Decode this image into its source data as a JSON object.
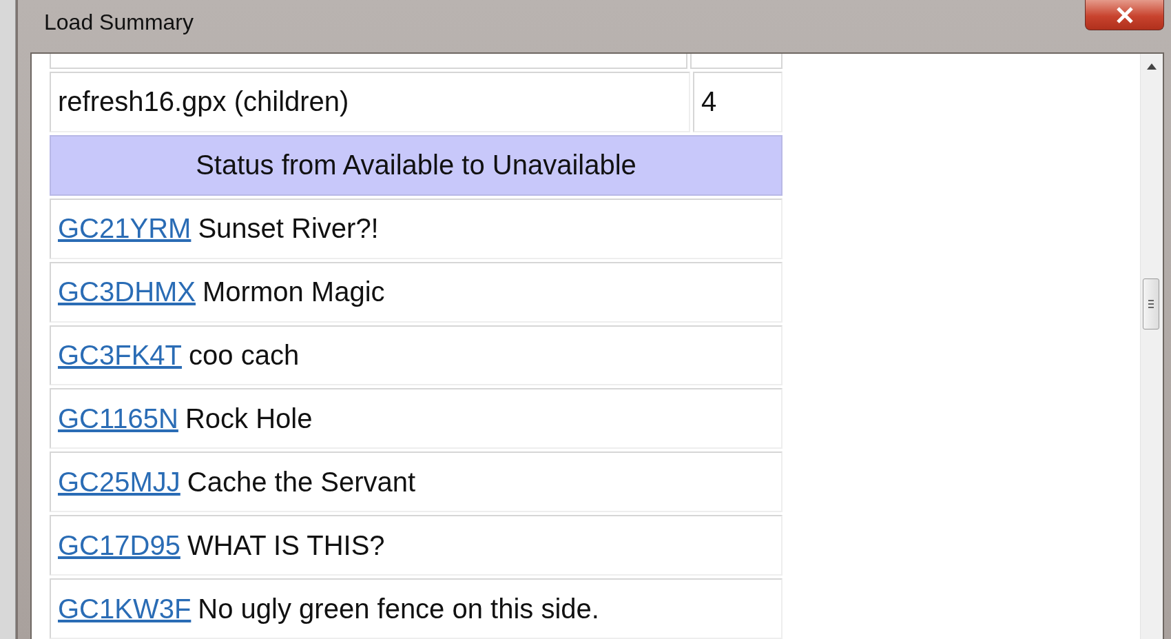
{
  "window": {
    "title": "Load Summary"
  },
  "table": {
    "rows": [
      {
        "kind": "file",
        "name": "refresh16.gpx (children)",
        "count": "4"
      },
      {
        "kind": "section",
        "title": "Status from Available to Unavailable"
      },
      {
        "kind": "cache",
        "code": "GC21YRM",
        "name": "Sunset River?!"
      },
      {
        "kind": "cache",
        "code": "GC3DHMX",
        "name": "Mormon Magic"
      },
      {
        "kind": "cache",
        "code": "GC3FK4T",
        "name": "coo cach"
      },
      {
        "kind": "cache",
        "code": "GC1165N",
        "name": "Rock Hole"
      },
      {
        "kind": "cache",
        "code": "GC25MJJ",
        "name": "Cache the Servant"
      },
      {
        "kind": "cache",
        "code": "GC17D95",
        "name": "WHAT IS THIS?"
      },
      {
        "kind": "cache",
        "code": "GC1KW3F",
        "name": "No ugly green fence on this side."
      }
    ]
  }
}
